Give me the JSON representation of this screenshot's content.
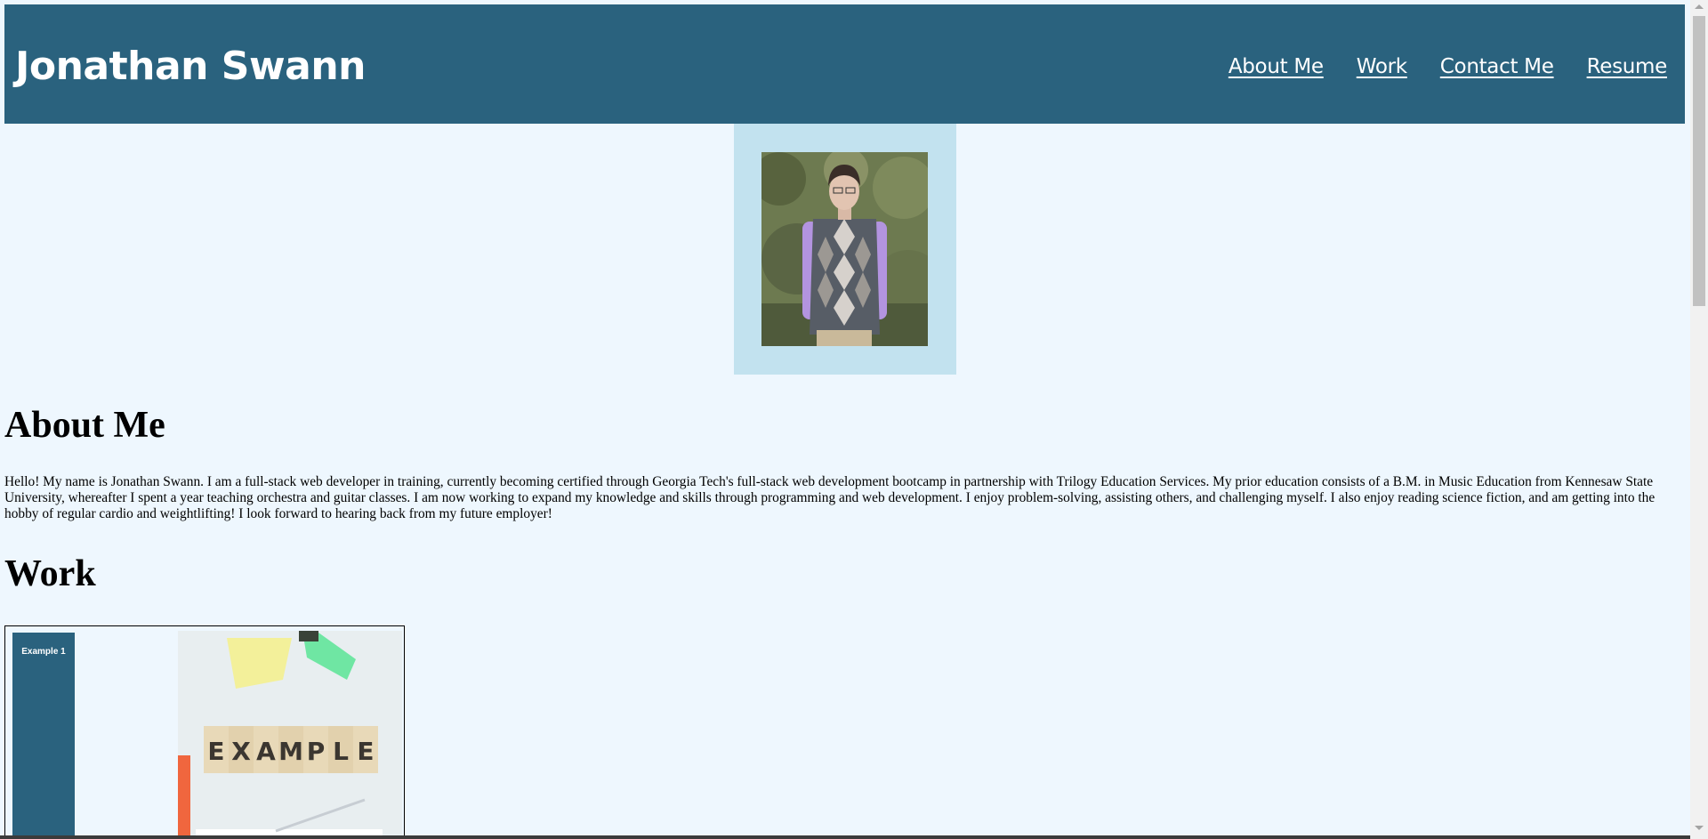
{
  "header": {
    "title": "Jonathan Swann",
    "nav": [
      "About Me",
      "Work",
      "Contact Me",
      "Resume"
    ]
  },
  "about": {
    "heading": "About Me",
    "text": "Hello! My name is Jonathan Swann. I am a full-stack web developer in training, currently becoming certified through Georgia Tech's full-stack web development bootcamp in partnership with Trilogy Education Services. My prior education consists of a B.M. in Music Education from Kennesaw State University, whereafter I spent a year teaching orchestra and guitar classes. I am now working to expand my knowledge and skills through programming and web development. I enjoy problem-solving, assisting others, and challenging myself. I also enjoy reading science fiction, and am getting into the hobby of regular cardio and weightlifting! I look forward to hearing back from my future employer!"
  },
  "work": {
    "heading": "Work",
    "cards": [
      {
        "label": "Example 1",
        "image_text": "EXAMPLE"
      }
    ]
  },
  "colors": {
    "header_bg": "#2a627e",
    "page_bg": "#eef7fe",
    "portrait_frame": "#c2e2ef"
  }
}
